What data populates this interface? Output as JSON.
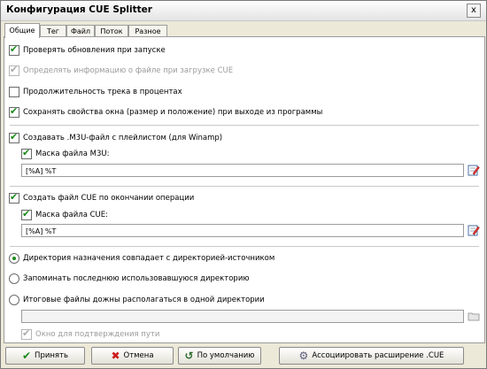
{
  "window": {
    "title": "Конфигурация CUE Splitter",
    "close_glyph": "x"
  },
  "tabs": [
    {
      "label": "Общие"
    },
    {
      "label": "Тег"
    },
    {
      "label": "Файл"
    },
    {
      "label": "Поток"
    },
    {
      "label": "Разное"
    }
  ],
  "general": {
    "check_updates": "Проверять обновления при запуске",
    "detect_file_info": "Определять информацию о файле при загрузке CUE",
    "duration_percent": "Продолжительность трека в процентах",
    "save_window_props": "Сохранять свойства окна (размер и положение) при выходе из программы",
    "create_m3u": "Создавать .M3U-файл с плейлистом (для Winamp)",
    "m3u_mask_label": "Маска файла M3U:",
    "m3u_mask_value": "[%A] %T",
    "create_cue": "Создать файл CUE по окончании операции",
    "cue_mask_label": "Маска файла CUE:",
    "cue_mask_value": "[%A] %T",
    "dest_same_as_source": "Директория назначения совпадает с директорией-источником",
    "remember_last_dir": "Запоминать последнюю использовавшуюся директорию",
    "single_dir": "Итоговые файлы дожны располагаться в одной директории",
    "single_dir_value": "",
    "confirm_path_window": "Окно для подтверждения пути"
  },
  "buttons": {
    "apply": "Принять",
    "cancel": "Отмена",
    "defaults": "По умолчанию",
    "associate_cue": "Ассоциировать расширение .CUE"
  },
  "colors": {
    "check_green": "#1a8a1a",
    "cancel_red": "#cc1a1a"
  }
}
